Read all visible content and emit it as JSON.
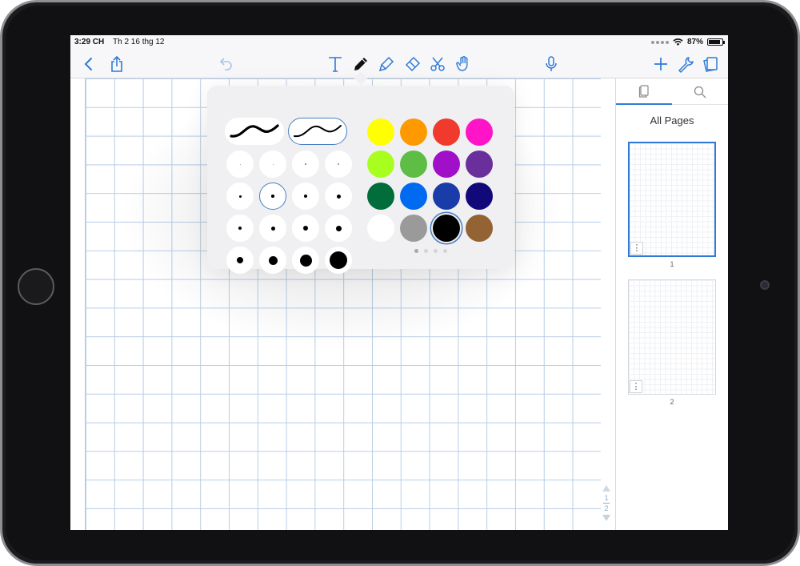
{
  "status_bar": {
    "time": "3:29 CH",
    "date": "Th 2 16 thg 12",
    "battery": "87%",
    "battery_level": 0.87
  },
  "toolbar": {
    "left": [
      {
        "name": "back-button",
        "icon": "chevron-left-icon"
      },
      {
        "name": "share-button",
        "icon": "share-icon"
      },
      {
        "name": "undo-button",
        "icon": "undo-icon"
      }
    ],
    "center": [
      {
        "name": "text-tool-button",
        "icon": "text-icon"
      },
      {
        "name": "pen-tool-button",
        "icon": "pen-icon",
        "active": true
      },
      {
        "name": "highlighter-tool-button",
        "icon": "highlighter-icon"
      },
      {
        "name": "eraser-tool-button",
        "icon": "eraser-icon"
      },
      {
        "name": "lasso-tool-button",
        "icon": "scissors-icon"
      },
      {
        "name": "hand-tool-button",
        "icon": "hand-icon"
      }
    ],
    "mic": {
      "name": "microphone-button",
      "icon": "microphone-icon"
    },
    "right": [
      {
        "name": "add-button",
        "icon": "plus-icon"
      },
      {
        "name": "settings-button",
        "icon": "wrench-icon"
      },
      {
        "name": "page-flip-button",
        "icon": "cards-icon"
      }
    ]
  },
  "pen_popover": {
    "styles": [
      {
        "name": "fountain-pen",
        "selected": false
      },
      {
        "name": "ballpoint-pen",
        "selected": true
      }
    ],
    "sizes": {
      "rows": 4,
      "cols": 4,
      "selected_index": 5
    },
    "colors": [
      {
        "hex": "#ffff00",
        "selected": false
      },
      {
        "hex": "#ff9900",
        "selected": false
      },
      {
        "hex": "#f03a2e",
        "selected": false
      },
      {
        "hex": "#ff14c8",
        "selected": false
      },
      {
        "hex": "#a8ff1f",
        "selected": false
      },
      {
        "hex": "#5ebd45",
        "selected": false
      },
      {
        "hex": "#a010c8",
        "selected": false
      },
      {
        "hex": "#6a2f9c",
        "selected": false
      },
      {
        "hex": "#006d3a",
        "selected": false
      },
      {
        "hex": "#006bf0",
        "selected": false
      },
      {
        "hex": "#1a3ca8",
        "selected": false
      },
      {
        "hex": "#11087a",
        "selected": false
      },
      {
        "hex": "#ffffff",
        "selected": false
      },
      {
        "hex": "#9a9a9a",
        "selected": false
      },
      {
        "hex": "#000000",
        "selected": true
      },
      {
        "hex": "#946334",
        "selected": false
      }
    ],
    "pages": 4,
    "current_page": 0
  },
  "page_indicator": {
    "current": "1",
    "total": "2"
  },
  "sidebar": {
    "title": "All Pages",
    "tabs": [
      {
        "name": "pages-tab",
        "icon": "pages-icon",
        "active": true
      },
      {
        "name": "search-tab",
        "icon": "search-icon",
        "active": false
      }
    ],
    "pages": [
      {
        "label": "1",
        "selected": true
      },
      {
        "label": "2",
        "selected": false
      }
    ],
    "page_menu_glyph": "⋮"
  },
  "colors": {
    "accent": "#2f7ad6",
    "grid": "#b9cde6"
  }
}
